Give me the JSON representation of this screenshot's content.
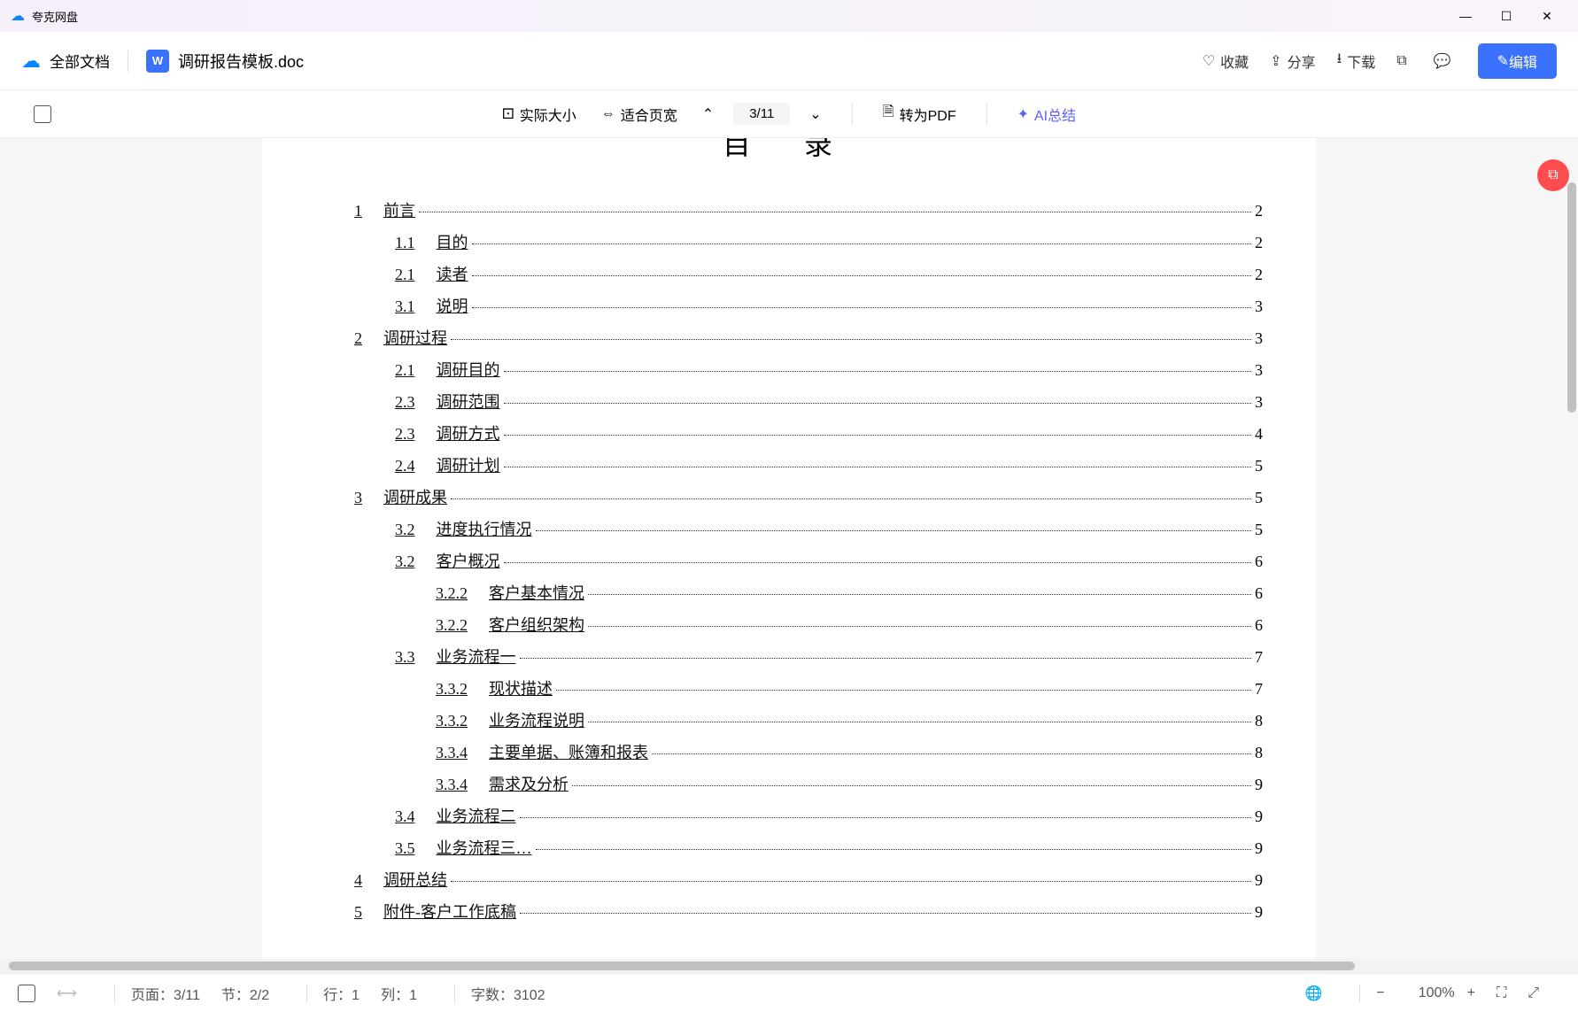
{
  "titlebar": {
    "app_name": "夸克网盘"
  },
  "toolbar": {
    "all_docs": "全部文档",
    "doc_icon": "W",
    "doc_name": "调研报告模板.doc",
    "favorite": "收藏",
    "share": "分享",
    "download": "下载",
    "edit": "编辑"
  },
  "subtoolbar": {
    "actual_size": "实际大小",
    "fit_width": "适合页宽",
    "page_indicator": "3/11",
    "to_pdf": "转为PDF",
    "ai_summary": "AI总结"
  },
  "document": {
    "heading": "目 录",
    "toc": [
      {
        "level": 0,
        "num": "1",
        "text": "前言",
        "page": "2"
      },
      {
        "level": 1,
        "num": "1.1",
        "text": "目的",
        "page": "2"
      },
      {
        "level": 1,
        "num": "2.1",
        "text": "读者",
        "page": "2"
      },
      {
        "level": 1,
        "num": "3.1",
        "text": "说明",
        "page": "3"
      },
      {
        "level": 0,
        "num": "2",
        "text": "调研过程",
        "page": "3"
      },
      {
        "level": 1,
        "num": "2.1",
        "text": "调研目的",
        "page": "3"
      },
      {
        "level": 1,
        "num": "2.3",
        "text": "调研范围",
        "page": "3"
      },
      {
        "level": 1,
        "num": "2.3",
        "text": "调研方式",
        "page": "4"
      },
      {
        "level": 1,
        "num": "2.4",
        "text": "调研计划",
        "page": "5"
      },
      {
        "level": 0,
        "num": "3",
        "text": "调研成果",
        "page": "5"
      },
      {
        "level": 1,
        "num": "3.2",
        "text": "进度执行情况",
        "page": "5"
      },
      {
        "level": 1,
        "num": "3.2",
        "text": "客户概况",
        "page": "6"
      },
      {
        "level": 2,
        "num": "3.2.2",
        "text": "客户基本情况",
        "page": "6"
      },
      {
        "level": 2,
        "num": "3.2.2",
        "text": "客户组织架构",
        "page": "6"
      },
      {
        "level": 1,
        "num": "3.3",
        "text": "业务流程一",
        "page": "7"
      },
      {
        "level": 2,
        "num": "3.3.2",
        "text": "现状描述",
        "page": "7"
      },
      {
        "level": 2,
        "num": "3.3.2",
        "text": "业务流程说明",
        "page": "8"
      },
      {
        "level": 2,
        "num": "3.3.4",
        "text": "主要单据、账簿和报表",
        "page": "8"
      },
      {
        "level": 2,
        "num": "3.3.4",
        "text": "需求及分析",
        "page": "9"
      },
      {
        "level": 1,
        "num": "3.4",
        "text": "业务流程二",
        "page": "9"
      },
      {
        "level": 1,
        "num": "3.5",
        "text": "业务流程三…",
        "page": "9"
      },
      {
        "level": 0,
        "num": "4",
        "text": "调研总结",
        "page": "9"
      },
      {
        "level": 0,
        "num": "5",
        "text": "附件-客户工作底稿",
        "page": "9"
      }
    ]
  },
  "statusbar": {
    "page": "页面：3/11",
    "section": "节：2/2",
    "row": "行：1",
    "col": "列：1",
    "words": "字数：3102",
    "zoom": "100%"
  }
}
